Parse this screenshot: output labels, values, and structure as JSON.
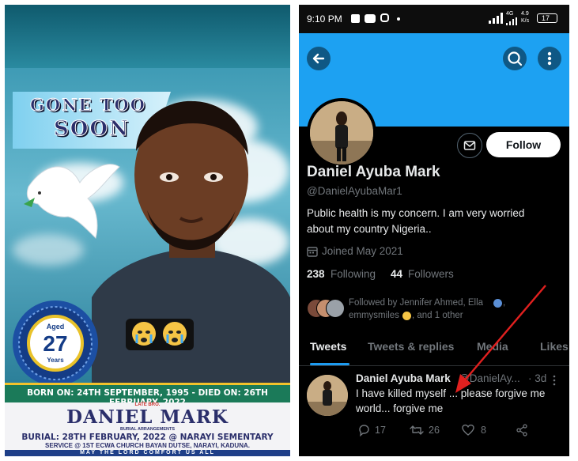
{
  "poster": {
    "banner_line1": "GONE TOO",
    "banner_line2": "SOON",
    "aged_label": "Aged",
    "age": "27",
    "years_label": "Years",
    "dates": "BORN ON: 24TH SEPTEMBER, 1995 - DIED ON: 26TH FEBRUARY, 2022",
    "late_label": "LATE BRO.",
    "name": "DANIEL MARK",
    "burial_arrangements": "BURIAL ARRANGEMENTS",
    "burial": "BURIAL: 28TH FEBRUARY, 2022 @ NARAYI SEMENTARY",
    "service": "SERVICE @ 1ST ECWA CHURCH BAYAN DUTSE, NARAYI, KADUNA.",
    "comfort": "MAY THE LORD COMFORT US ALL"
  },
  "status_bar": {
    "time": "9:10 PM",
    "network": "4G",
    "speed": "4.9",
    "speed_unit": "K/s",
    "battery": "17"
  },
  "profile": {
    "display_name": "Daniel Ayuba Mark",
    "handle": "@DanielAyubaMar1",
    "bio_line1": "Public health is my concern. I am very worried",
    "bio_line2": "about my country Nigeria..",
    "joined": "Joined May 2021",
    "following_count": "238",
    "following_label": "Following",
    "followers_count": "44",
    "followers_label": "Followers",
    "followed_by_line1": "Followed by Jennifer Ahmed, Ella",
    "followed_by_line2": "emmysmiles",
    "followed_by_line2b": ", and 1 other",
    "follow_button": "Follow"
  },
  "tabs": [
    "Tweets",
    "Tweets & replies",
    "Media",
    "Likes"
  ],
  "tweet": {
    "author": "Daniel Ayuba Mark",
    "handle": "@DanielAy...",
    "age": "· 3d",
    "text_line1": "I have killed myself ... please forgive me",
    "text_line2": "world... forgive me",
    "replies": "17",
    "retweets": "26",
    "likes": "8"
  },
  "colors": {
    "twitter_blue": "#1da1f2",
    "accent": "#1d9bf0",
    "poster_name": "#2b2f6b",
    "arrow": "#e0201f"
  },
  "icons": [
    "back-arrow-icon",
    "search-icon",
    "more-vertical-icon",
    "mail-icon",
    "calendar-icon",
    "reply-icon",
    "retweet-icon",
    "heart-icon",
    "share-icon",
    "crying-emoji-icon",
    "dove-icon"
  ]
}
